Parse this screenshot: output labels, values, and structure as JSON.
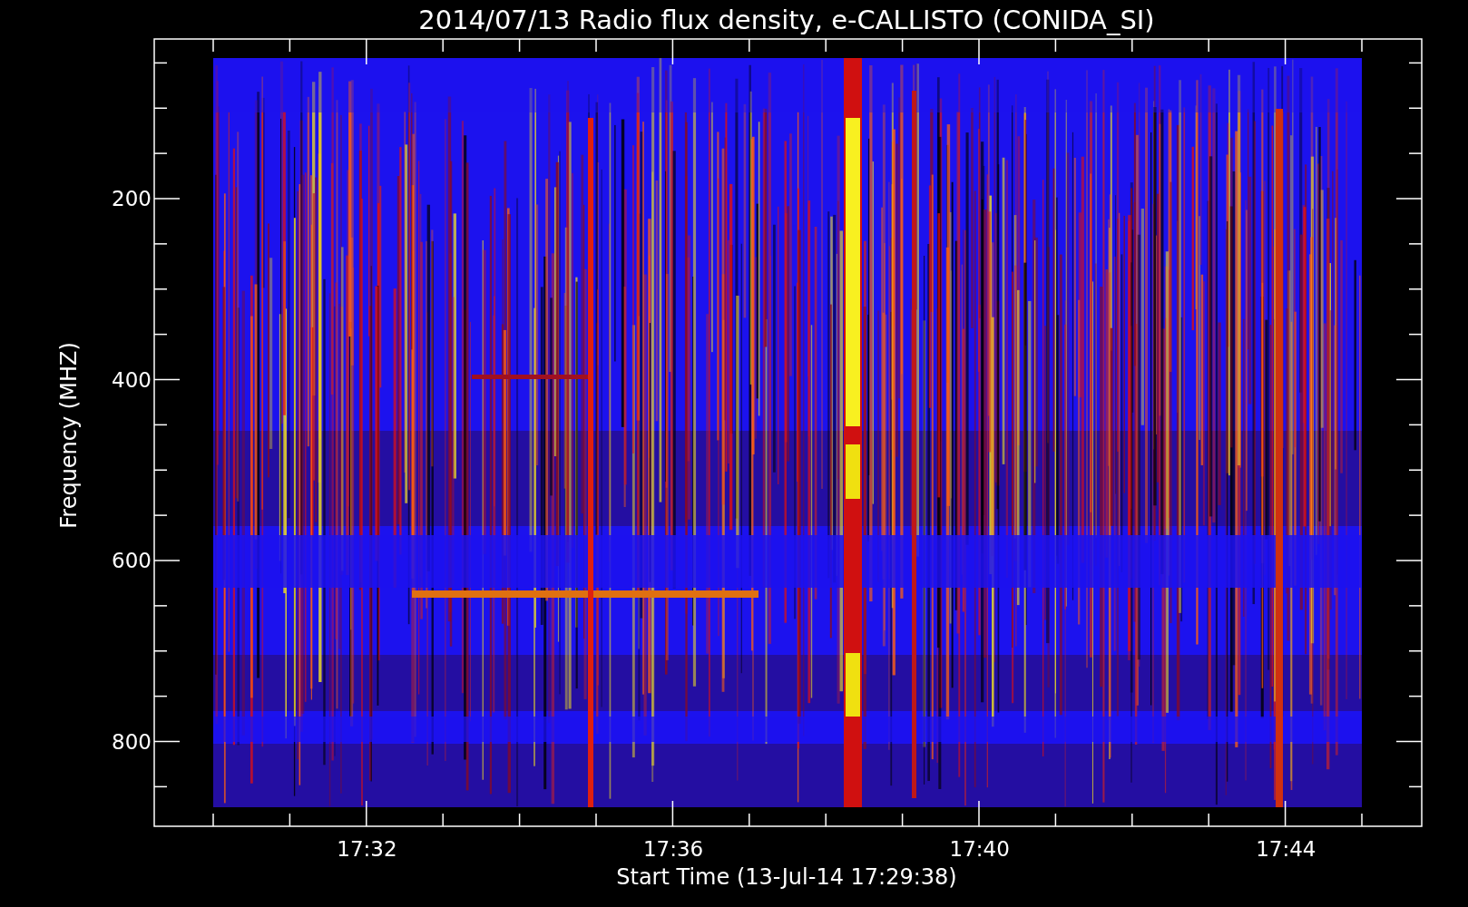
{
  "title": "2014/07/13  Radio flux density, e-CALLISTO (CONIDA_SI)",
  "y_axis": {
    "label": "Frequency (MHZ)",
    "ticks": [
      "200",
      "400",
      "600",
      "800"
    ]
  },
  "x_axis": {
    "label": "Start Time (13-Jul-14 17:29:38)",
    "ticks": [
      "17:32",
      "17:36",
      "17:40",
      "17:44"
    ]
  }
}
